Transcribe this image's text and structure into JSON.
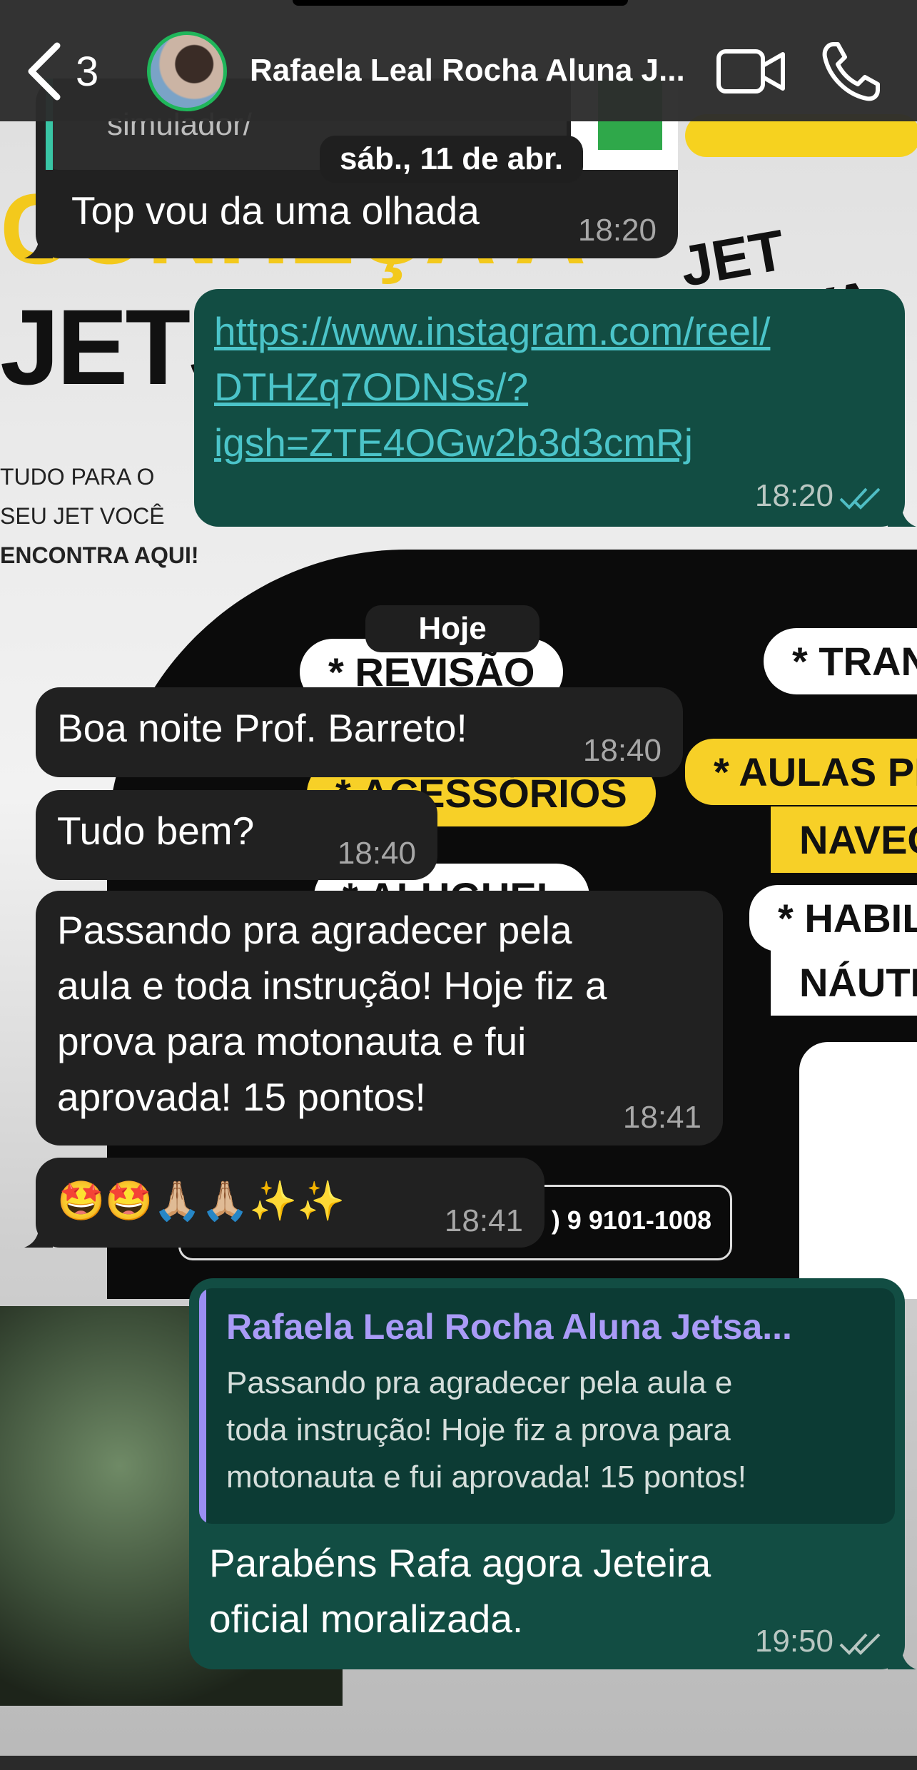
{
  "header": {
    "back_count": "3",
    "contact_name": "Rafaela Leal Rocha Aluna J..."
  },
  "dates": {
    "previous": "sáb., 11 de abr.",
    "today": "Hoje"
  },
  "messages": [
    {
      "id": "m0",
      "direction": "in",
      "partial_text": "simulador/",
      "text": "Top vou da uma olhada",
      "time": "18:20"
    },
    {
      "id": "m1",
      "direction": "out",
      "text": "https://www.instagram.com/reel/\nDTHZq7ODNSs/?\nigsh=ZTE4OGw2b3d3cmRj",
      "time": "18:20",
      "link": true,
      "status": "read"
    },
    {
      "id": "m2",
      "direction": "in",
      "text": "Boa noite Prof. Barreto!",
      "time": "18:40"
    },
    {
      "id": "m3",
      "direction": "in",
      "text": "Tudo bem?",
      "time": "18:40"
    },
    {
      "id": "m4",
      "direction": "in",
      "text": "Passando pra agradecer pela\naula e toda instrução! Hoje fiz a\nprova para motonauta e fui\naprovada! 15 pontos!",
      "time": "18:41"
    },
    {
      "id": "m5",
      "direction": "in",
      "text": "🤩🤩🙏🏼🙏🏼✨✨",
      "time": "18:41"
    },
    {
      "id": "m6",
      "direction": "out",
      "quote_author": "Rafaela Leal Rocha Aluna Jetsa...",
      "quote_text": "Passando pra agradecer pela aula e\ntoda instrução! Hoje fiz a prova para\nmotonauta e fui aprovada! 15 pontos!",
      "text": "Parabéns Rafa agora Jeteira\noficial moralizada.",
      "time": "19:50",
      "status": "read"
    }
  ],
  "wallpaper": {
    "logo_text": "JETSA",
    "logo_top_text": "CONHEÇA A",
    "tagline_1": "TUDO PARA O",
    "tagline_2": "SEU JET VOCÊ",
    "tagline_3": "ENCONTRA AQUI!",
    "brand": "JET SALVA",
    "pills": [
      "* REVISÃO",
      "* TRAN",
      "* ACESSÓRIOS",
      "* AULAS PRA",
      "NAVEGA",
      "* ALUGUEL",
      "* HABIL",
      "NÁUTIC"
    ],
    "phone": ") 9 9101-1008"
  },
  "colors": {
    "incoming_bubble": "#212121",
    "outgoing_bubble": "#124d43",
    "quote_accent": "#9b8ef2",
    "link": "#4bc4c9",
    "online_ring": "#1fb65a"
  },
  "icons": {
    "back": "chevron-left-icon",
    "video": "video-camera-icon",
    "call": "phone-icon",
    "read": "double-check-icon"
  }
}
